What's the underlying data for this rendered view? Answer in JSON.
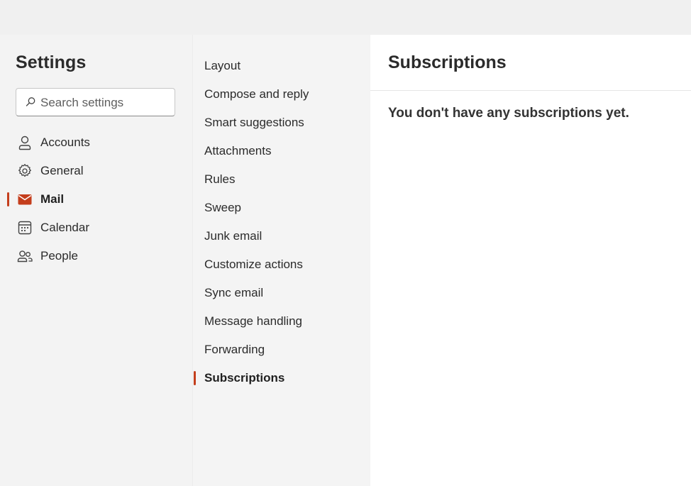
{
  "settings": {
    "title": "Settings",
    "search_placeholder": "Search settings"
  },
  "nav": [
    {
      "label": "Accounts",
      "icon": "person-icon",
      "active": false
    },
    {
      "label": "General",
      "icon": "gear-icon",
      "active": false
    },
    {
      "label": "Mail",
      "icon": "mail-icon",
      "active": true
    },
    {
      "label": "Calendar",
      "icon": "calendar-icon",
      "active": false
    },
    {
      "label": "People",
      "icon": "people-icon",
      "active": false
    }
  ],
  "mail_sections": [
    "Layout",
    "Compose and reply",
    "Smart suggestions",
    "Attachments",
    "Rules",
    "Sweep",
    "Junk email",
    "Customize actions",
    "Sync email",
    "Message handling",
    "Forwarding",
    "Subscriptions"
  ],
  "mail_sections_active": "Subscriptions",
  "content": {
    "title": "Subscriptions",
    "empty_message": "You don't have any subscriptions yet."
  },
  "colors": {
    "accent": "#c43e1c",
    "panel_bg": "#f3f3f3",
    "content_bg": "#ffffff"
  }
}
